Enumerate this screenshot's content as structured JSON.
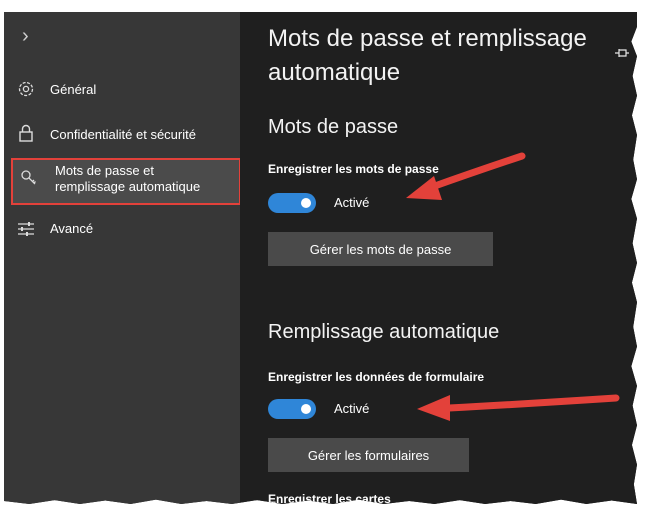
{
  "sidebar": {
    "expand_glyph": "›",
    "items": [
      {
        "label": "Général",
        "icon": "gear-icon"
      },
      {
        "label": "Confidentialité et sécurité",
        "icon": "lock-icon"
      },
      {
        "label_line1": "Mots de passe et",
        "label_line2": "remplissage automatique",
        "icon": "key-icon",
        "selected": true
      },
      {
        "label": "Avancé",
        "icon": "sliders-icon"
      }
    ]
  },
  "main": {
    "title": "Mots de passe et remplissage automatique",
    "passwords": {
      "heading": "Mots de passe",
      "save_label": "Enregistrer les mots de passe",
      "toggle_state": "Activé",
      "manage_button": "Gérer les mots de passe"
    },
    "autofill": {
      "heading": "Remplissage automatique",
      "save_label": "Enregistrer les données de formulaire",
      "toggle_state": "Activé",
      "manage_button": "Gérer les formulaires"
    },
    "next_label": "Enregistrer les cartes"
  },
  "colors": {
    "sidebar_bg": "#373737",
    "main_bg": "#1f1f1f",
    "toggle_on": "#2f86d8",
    "selection_outline": "#e3413a",
    "arrow": "#e3413a"
  }
}
